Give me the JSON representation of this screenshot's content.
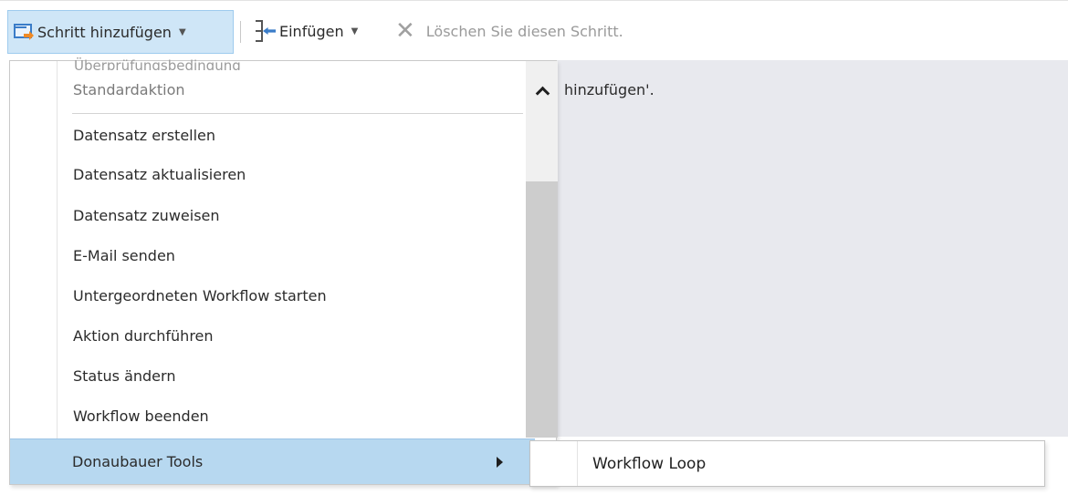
{
  "toolbar": {
    "add_step_label": "Schritt hinzufügen",
    "insert_label": "Einfügen",
    "delete_label": "Löschen Sie diesen Schritt."
  },
  "content": {
    "hint_fragment": "hinzufügen'."
  },
  "menu": {
    "cut_item": "Überprüfungsbedingung",
    "header": "Standardaktion",
    "items": [
      {
        "label": "Datensatz erstellen"
      },
      {
        "label": "Datensatz aktualisieren"
      },
      {
        "label": "Datensatz zuweisen"
      },
      {
        "label": "E-Mail senden"
      },
      {
        "label": "Untergeordneten Workflow starten"
      },
      {
        "label": "Aktion durchführen"
      },
      {
        "label": "Status ändern"
      },
      {
        "label": "Workflow beenden"
      }
    ],
    "submenu_trigger": "Donaubauer Tools"
  },
  "submenu": {
    "items": [
      {
        "label": "Workflow Loop"
      }
    ]
  },
  "colors": {
    "highlight": "#b7d8f0",
    "toolbar_active": "#cfe6f7",
    "content_bg": "#e8e9ee",
    "scroll_thumb": "#cdcdcd"
  }
}
